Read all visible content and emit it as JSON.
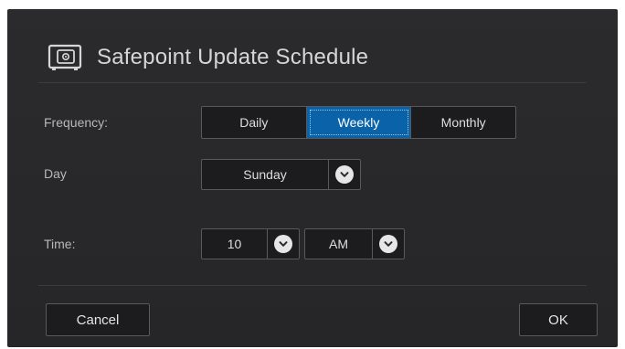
{
  "dialog": {
    "title": "Safepoint Update Schedule",
    "icon": "safe-icon"
  },
  "frequency": {
    "label": "Frequency:",
    "options": [
      "Daily",
      "Weekly",
      "Monthly"
    ],
    "selected": "Weekly"
  },
  "day": {
    "label": "Day",
    "value": "Sunday"
  },
  "time": {
    "label": "Time:",
    "hour": "10",
    "ampm": "AM"
  },
  "footer": {
    "cancel_label": "Cancel",
    "ok_label": "OK"
  },
  "colors": {
    "dialog_bg": "#2b2b2d",
    "accent": "#0a63a8",
    "text": "#dedee0"
  }
}
